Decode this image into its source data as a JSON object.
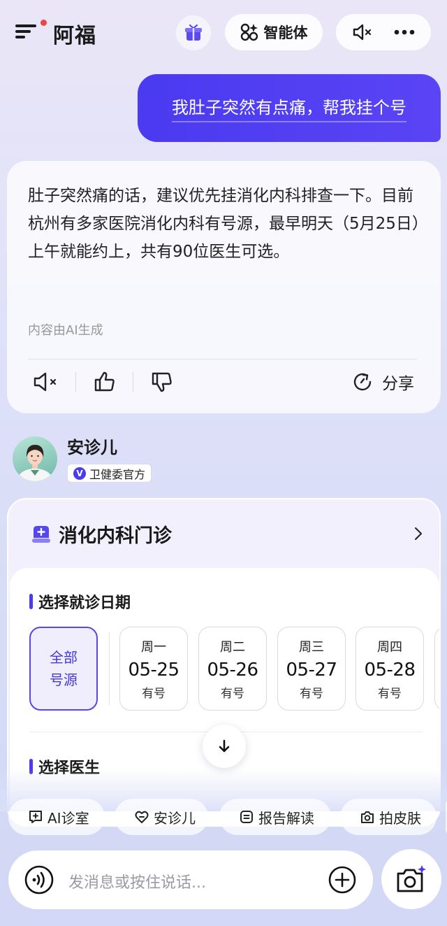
{
  "header": {
    "app_title": "阿福",
    "agent_button_label": "智能体",
    "icons": [
      "menu-icon",
      "gift-icon",
      "grid-icon",
      "mute-icon",
      "more-icon"
    ]
  },
  "user_message": "我肚子突然有点痛，帮我挂个号",
  "ai_reply": {
    "text": "肚子突然痛的话，建议优先挂消化内科排查一下。目前杭州有多家医院消化内科有号源，最早明天（5月25日）上午就能约上，共有90位医生可选。",
    "note": "内容由AI生成",
    "share_label": "分享"
  },
  "agent": {
    "name": "安诊儿",
    "badge_label": "卫健委官方",
    "badge_mark": "V"
  },
  "clinic": {
    "title": "消化内科门诊",
    "date_section_title": "选择就诊日期",
    "all_dates_label_line1": "全部",
    "all_dates_label_line2": "号源",
    "dates": [
      {
        "weekday": "周一",
        "date": "05-25",
        "status": "有号"
      },
      {
        "weekday": "周二",
        "date": "05-26",
        "status": "有号"
      },
      {
        "weekday": "周三",
        "date": "05-27",
        "status": "有号"
      },
      {
        "weekday": "周四",
        "date": "05-28",
        "status": "有号"
      }
    ],
    "doctor_section_title": "选择医生"
  },
  "quick_actions": [
    {
      "label": "AI诊室",
      "icon": "plus-chat-icon"
    },
    {
      "label": "安诊儿",
      "icon": "heart-icon"
    },
    {
      "label": "报告解读",
      "icon": "report-icon"
    },
    {
      "label": "拍皮肤",
      "icon": "camera-icon"
    }
  ],
  "input": {
    "placeholder": "发消息或按住说话..."
  },
  "colors": {
    "accent": "#4a3af0",
    "background": "#dfe1f8"
  }
}
